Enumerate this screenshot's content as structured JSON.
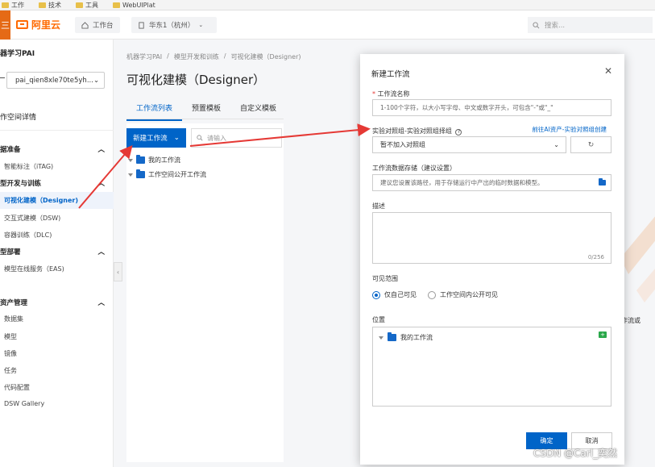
{
  "bookmarks": [
    {
      "label": "工作"
    },
    {
      "label": "技术"
    },
    {
      "label": "工具"
    },
    {
      "label": "WebUIPlat"
    }
  ],
  "topbar": {
    "logo_icon": "三",
    "logo_text": "阿里云",
    "workbench_label": "工作台",
    "region_label": "华东1（杭州）",
    "search_placeholder": "搜索..."
  },
  "sidebar": {
    "product_title": "器学习PAI",
    "workspace_select": "pai_qien8xle70te5yh...",
    "workspace_detail": "作空间详情",
    "groups": [
      {
        "label": "据准备",
        "items": [
          "智能标注（iTAG)"
        ]
      },
      {
        "label": "型开发与训练",
        "items": [
          "可视化建模（Designer)",
          "交互式建模（DSW)",
          "容器训练（DLC)"
        ]
      },
      {
        "label": "型部署",
        "items": [
          "模型在线服务（EAS)"
        ]
      },
      {
        "label": "资产管理",
        "items": [
          "数据集",
          "模型",
          "镜像",
          "任务",
          "代码配置",
          "DSW Gallery"
        ]
      }
    ]
  },
  "main": {
    "breadcrumb": [
      "机器学习PAI",
      "/",
      "模型开发和训练",
      "/",
      "可视化建模（Designer)"
    ],
    "title": "可视化建模（Designer）",
    "tabs": [
      "工作流列表",
      "预置模板",
      "自定义模板"
    ],
    "new_workflow_label": "新建工作流",
    "search_placeholder": "请输入",
    "tree": [
      "我的工作流",
      "工作空间公开工作流"
    ],
    "right_overflow_text": "工作流或"
  },
  "modal": {
    "title": "新建工作流",
    "name_label": "工作流名称",
    "name_placeholder": "1-100个字符，以大小写字母、中文或数字开头，可包含\"-\"或\"_\"",
    "group_label": "实验对照组-实验对照组择组",
    "group_link": "前往AI资产-实验对照组创建",
    "group_value": "暂不加入对照组",
    "storage_label": "工作流数据存储（建议设置）",
    "storage_placeholder": "建议您设置该路径，用于存储运行中产出的临时数据和模型。",
    "desc_label": "描述",
    "desc_count": "0/256",
    "visibility_label": "可见范围",
    "visibility_options": [
      "仅自己可见",
      "工作空间内公开可见"
    ],
    "location_label": "位置",
    "location_item": "我的工作流",
    "ok_label": "确定",
    "cancel_label": "取消"
  },
  "watermark": "CSDN @Carl_奕然",
  "colors": {
    "brand": "#ff6a00",
    "primary": "#0064c8",
    "arrow": "#e53935"
  }
}
